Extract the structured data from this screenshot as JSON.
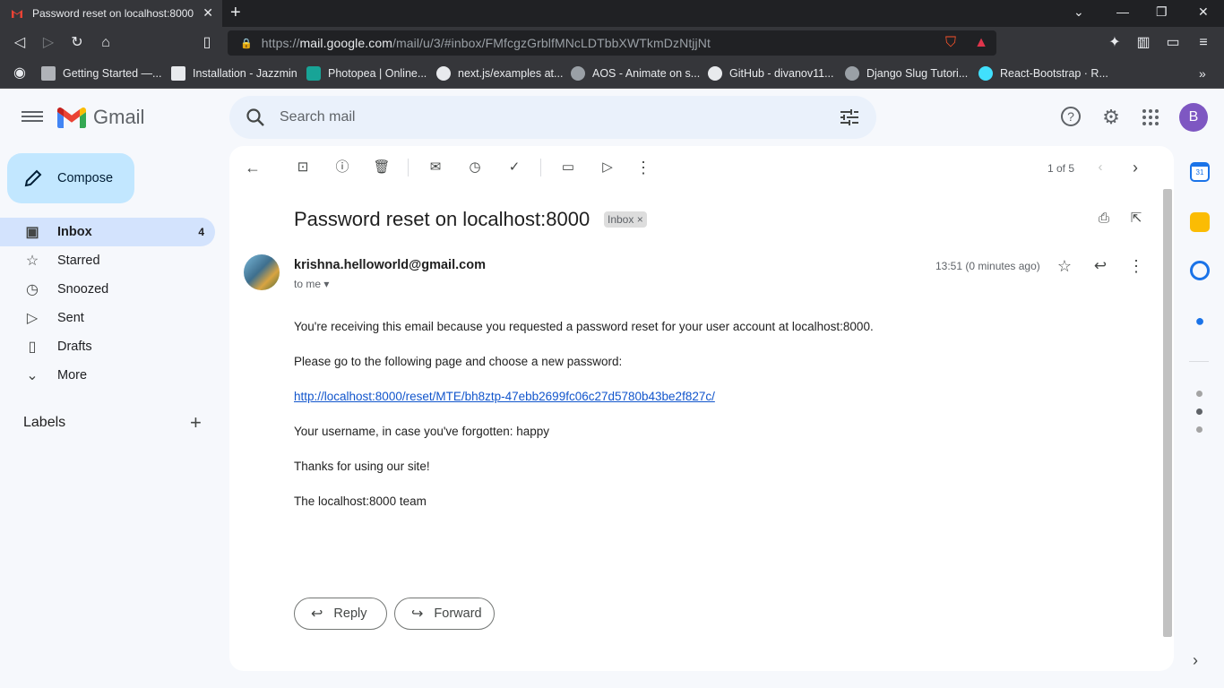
{
  "browser": {
    "tab_title": "Password reset on localhost:8000",
    "url_host": "mail.google.com",
    "url_prefix": "https://",
    "url_path": "/mail/u/3/#inbox/FMfcgzGrblfMNcLDTbbXWTkmDzNtjjNt",
    "bookmarks": [
      "Getting Started —...",
      "Installation - Jazzmin",
      "Photopea | Online...",
      "next.js/examples at...",
      "AOS - Animate on s...",
      "GitHub - divanov11...",
      "Django Slug Tutori...",
      "React-Bootstrap · R..."
    ]
  },
  "gmail": {
    "logo_text": "Gmail",
    "search_placeholder": "Search mail",
    "avatar_letter": "B",
    "compose_label": "Compose",
    "nav": [
      {
        "label": "Inbox",
        "count": "4"
      },
      {
        "label": "Starred"
      },
      {
        "label": "Snoozed"
      },
      {
        "label": "Sent"
      },
      {
        "label": "Drafts"
      },
      {
        "label": "More"
      }
    ],
    "labels_heading": "Labels"
  },
  "mail": {
    "pager": "1 of 5",
    "subject": "Password reset on localhost:8000",
    "chip": "Inbox",
    "sender": "krishna.helloworld@gmail.com",
    "to": "to me",
    "time": "13:51 (0 minutes ago)",
    "body": [
      "You're receiving this email because you requested a password reset for your user account at localhost:8000.",
      "Please go to the following page and choose a new password:",
      "http://localhost:8000/reset/MTE/bh8ztp-47ebb2699fc06c27d5780b43be2f827c/",
      "Your username, in case you've forgotten: happy",
      "Thanks for using our site!",
      "The localhost:8000 team"
    ],
    "reply_label": "Reply",
    "forward_label": "Forward"
  },
  "colors": {
    "accent": "#c2e7ff",
    "active_nav": "#d3e3fd",
    "avatar": "#7e57c2"
  }
}
